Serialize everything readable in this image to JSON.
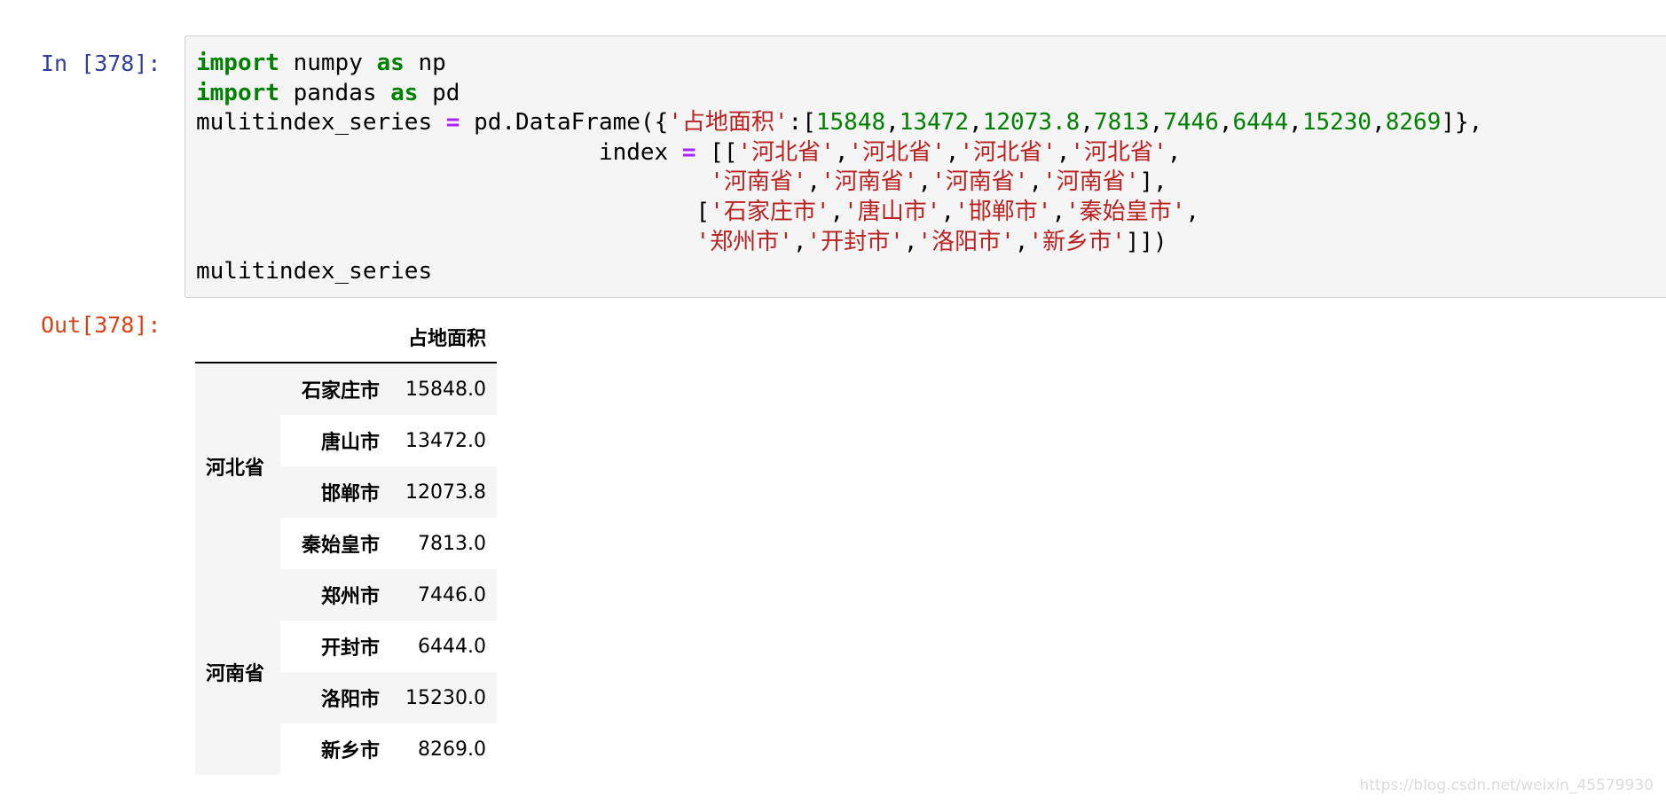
{
  "cells": {
    "input_prompt": "In [378]:",
    "output_prompt": "Out[378]:",
    "code_lines": [
      [
        {
          "t": "import",
          "c": "kw"
        },
        {
          "t": " numpy ",
          "c": ""
        },
        {
          "t": "as",
          "c": "kw"
        },
        {
          "t": " np",
          "c": ""
        }
      ],
      [
        {
          "t": "import",
          "c": "kw"
        },
        {
          "t": " pandas ",
          "c": ""
        },
        {
          "t": "as",
          "c": "kw"
        },
        {
          "t": " pd",
          "c": ""
        }
      ],
      [
        {
          "t": "mulitindex_series ",
          "c": ""
        },
        {
          "t": "=",
          "c": "op"
        },
        {
          "t": " pd.DataFrame({",
          "c": ""
        },
        {
          "t": "'占地面积'",
          "c": "str"
        },
        {
          "t": ":[",
          "c": ""
        },
        {
          "t": "15848",
          "c": "num"
        },
        {
          "t": ",",
          "c": ""
        },
        {
          "t": "13472",
          "c": "num"
        },
        {
          "t": ",",
          "c": ""
        },
        {
          "t": "12073.8",
          "c": "num"
        },
        {
          "t": ",",
          "c": ""
        },
        {
          "t": "7813",
          "c": "num"
        },
        {
          "t": ",",
          "c": ""
        },
        {
          "t": "7446",
          "c": "num"
        },
        {
          "t": ",",
          "c": ""
        },
        {
          "t": "6444",
          "c": "num"
        },
        {
          "t": ",",
          "c": ""
        },
        {
          "t": "15230",
          "c": "num"
        },
        {
          "t": ",",
          "c": ""
        },
        {
          "t": "8269",
          "c": "num"
        },
        {
          "t": "]},",
          "c": ""
        }
      ],
      [
        {
          "t": "                             index ",
          "c": ""
        },
        {
          "t": "=",
          "c": "op"
        },
        {
          "t": " [[",
          "c": ""
        },
        {
          "t": "'河北省'",
          "c": "str"
        },
        {
          "t": ",",
          "c": ""
        },
        {
          "t": "'河北省'",
          "c": "str"
        },
        {
          "t": ",",
          "c": ""
        },
        {
          "t": "'河北省'",
          "c": "str"
        },
        {
          "t": ",",
          "c": ""
        },
        {
          "t": "'河北省'",
          "c": "str"
        },
        {
          "t": ",",
          "c": ""
        }
      ],
      [
        {
          "t": "                                     ",
          "c": ""
        },
        {
          "t": "'河南省'",
          "c": "str"
        },
        {
          "t": ",",
          "c": ""
        },
        {
          "t": "'河南省'",
          "c": "str"
        },
        {
          "t": ",",
          "c": ""
        },
        {
          "t": "'河南省'",
          "c": "str"
        },
        {
          "t": ",",
          "c": ""
        },
        {
          "t": "'河南省'",
          "c": "str"
        },
        {
          "t": "],",
          "c": ""
        }
      ],
      [
        {
          "t": "                                    [",
          "c": ""
        },
        {
          "t": "'石家庄市'",
          "c": "str"
        },
        {
          "t": ",",
          "c": ""
        },
        {
          "t": "'唐山市'",
          "c": "str"
        },
        {
          "t": ",",
          "c": ""
        },
        {
          "t": "'邯郸市'",
          "c": "str"
        },
        {
          "t": ",",
          "c": ""
        },
        {
          "t": "'秦始皇市'",
          "c": "str"
        },
        {
          "t": ",",
          "c": ""
        }
      ],
      [
        {
          "t": "                                    ",
          "c": ""
        },
        {
          "t": "'郑州市'",
          "c": "str"
        },
        {
          "t": ",",
          "c": ""
        },
        {
          "t": "'开封市'",
          "c": "str"
        },
        {
          "t": ",",
          "c": ""
        },
        {
          "t": "'洛阳市'",
          "c": "str"
        },
        {
          "t": ",",
          "c": ""
        },
        {
          "t": "'新乡市'",
          "c": "str"
        },
        {
          "t": "]])",
          "c": ""
        }
      ],
      [
        {
          "t": "mulitindex_series",
          "c": ""
        }
      ]
    ]
  },
  "output_table": {
    "column_header": "占地面积",
    "groups": [
      {
        "label": "河北省",
        "rows": [
          {
            "city": "石家庄市",
            "value": "15848.0"
          },
          {
            "city": "唐山市",
            "value": "13472.0"
          },
          {
            "city": "邯郸市",
            "value": "12073.8"
          },
          {
            "city": "秦始皇市",
            "value": "7813.0"
          }
        ]
      },
      {
        "label": "河南省",
        "rows": [
          {
            "city": "郑州市",
            "value": "7446.0"
          },
          {
            "city": "开封市",
            "value": "6444.0"
          },
          {
            "city": "洛阳市",
            "value": "15230.0"
          },
          {
            "city": "新乡市",
            "value": "8269.0"
          }
        ]
      }
    ]
  },
  "watermark": "https://blog.csdn.net/weixin_45579930",
  "colors": {
    "keyword": "#008000",
    "operator": "#aa22ff",
    "string": "#ba2121",
    "number": "#008000",
    "in_prompt": "#303f9f",
    "out_prompt": "#d84315",
    "cell_background": "#f5f5f5",
    "stripe": "#f5f5f5"
  }
}
